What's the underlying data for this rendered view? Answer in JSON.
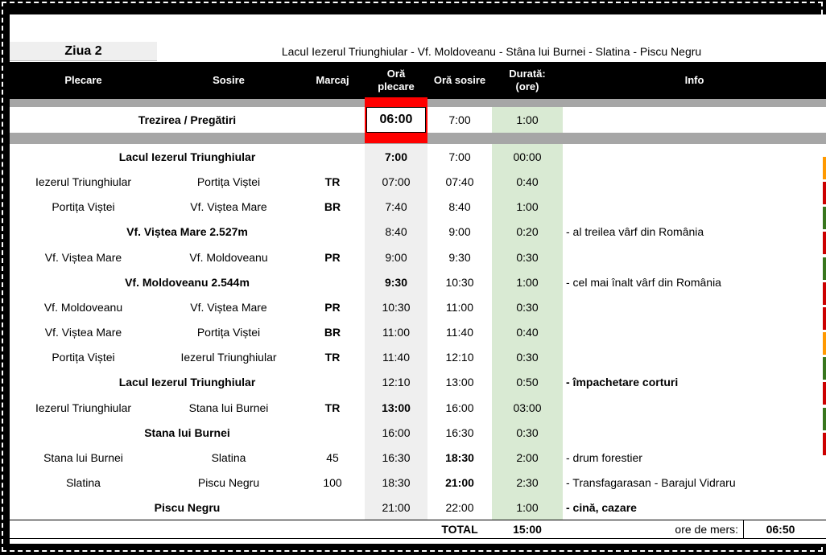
{
  "day": {
    "label": "Ziua 2",
    "route": "Lacul Iezerul Triunghiular - Vf. Moldoveanu - Stâna lui Burnei - Slatina - Piscu Negru"
  },
  "headers": {
    "plecare": "Plecare",
    "sosire": "Sosire",
    "marcaj": "Marcaj",
    "ora_plecare": "Oră plecare",
    "ora_sosire": "Oră sosire",
    "durata": "Durată: (ore)",
    "info": "Info"
  },
  "wake": {
    "label": "Trezirea / Pregătiri",
    "start": "06:00",
    "end": "7:00",
    "duration": "1:00"
  },
  "rows": [
    {
      "merged": "Lacul Iezerul Triunghiular",
      "from": "",
      "to": "",
      "marker": "",
      "start": "7:00",
      "end": "7:00",
      "duration": "00:00",
      "info": "",
      "startBold": true,
      "endBold": false,
      "infoBold": false
    },
    {
      "merged": "",
      "from": "Iezerul Triunghiular",
      "to": "Portița Viștei",
      "marker": "TR",
      "start": "07:00",
      "end": "07:40",
      "duration": "0:40",
      "info": "",
      "startBold": false,
      "endBold": false,
      "infoBold": false
    },
    {
      "merged": "",
      "from": "Portița Viștei",
      "to": "Vf. Viștea Mare",
      "marker": "BR",
      "start": "7:40",
      "end": "8:40",
      "duration": "1:00",
      "info": "",
      "startBold": false,
      "endBold": false,
      "infoBold": false
    },
    {
      "merged": "Vf. Viștea Mare 2.527m",
      "from": "",
      "to": "",
      "marker": "",
      "start": "8:40",
      "end": "9:00",
      "duration": "0:20",
      "info": "-  al treilea vârf din România",
      "startBold": false,
      "endBold": false,
      "infoBold": false
    },
    {
      "merged": "",
      "from": "Vf. Viștea Mare",
      "to": "Vf. Moldoveanu",
      "marker": "PR",
      "start": "9:00",
      "end": "9:30",
      "duration": "0:30",
      "info": "",
      "startBold": false,
      "endBold": false,
      "infoBold": false
    },
    {
      "merged": "Vf. Moldoveanu 2.544m",
      "from": "",
      "to": "",
      "marker": "",
      "start": "9:30",
      "end": "10:30",
      "duration": "1:00",
      "info": "-  cel mai înalt vârf din România",
      "startBold": true,
      "endBold": false,
      "infoBold": false
    },
    {
      "merged": "",
      "from": "Vf. Moldoveanu",
      "to": "Vf. Viștea Mare",
      "marker": "PR",
      "start": "10:30",
      "end": "11:00",
      "duration": "0:30",
      "info": "",
      "startBold": false,
      "endBold": false,
      "infoBold": false
    },
    {
      "merged": "",
      "from": "Vf. Viștea Mare",
      "to": "Portița Viștei",
      "marker": "BR",
      "start": "11:00",
      "end": "11:40",
      "duration": "0:40",
      "info": "",
      "startBold": false,
      "endBold": false,
      "infoBold": false
    },
    {
      "merged": "",
      "from": "Portița Viștei",
      "to": "Iezerul Triunghiular",
      "marker": "TR",
      "start": "11:40",
      "end": "12:10",
      "duration": "0:30",
      "info": "",
      "startBold": false,
      "endBold": false,
      "infoBold": false
    },
    {
      "merged": "Lacul Iezerul Triunghiular",
      "from": "",
      "to": "",
      "marker": "",
      "start": "12:10",
      "end": "13:00",
      "duration": "0:50",
      "info": " - împachetare corturi",
      "startBold": false,
      "endBold": false,
      "infoBold": true
    },
    {
      "merged": "",
      "from": "Iezerul Triunghiular",
      "to": "Stana lui Burnei",
      "marker": "TR",
      "start": "13:00",
      "end": "16:00",
      "duration": "03:00",
      "info": "",
      "startBold": true,
      "endBold": false,
      "infoBold": false
    },
    {
      "merged": "Stana lui Burnei",
      "from": "",
      "to": "",
      "marker": "",
      "start": "16:00",
      "end": "16:30",
      "duration": "0:30",
      "info": "",
      "startBold": false,
      "endBold": false,
      "infoBold": false
    },
    {
      "merged": "",
      "from": "Stana lui Burnei",
      "to": "Slatina",
      "marker": "45",
      "start": "16:30",
      "end": "18:30",
      "duration": "2:00",
      "info": "-  drum forestier",
      "startBold": false,
      "endBold": true,
      "infoBold": false
    },
    {
      "merged": "",
      "from": "Slatina",
      "to": "Piscu Negru",
      "marker": "100",
      "start": "18:30",
      "end": "21:00",
      "duration": "2:30",
      "info": "- Transfagarasan - Barajul Vidraru",
      "startBold": false,
      "endBold": true,
      "infoBold": false
    },
    {
      "merged": "Piscu Negru",
      "from": "",
      "to": "",
      "marker": "",
      "start": "21:00",
      "end": "22:00",
      "duration": "1:00",
      "info": "-  cină, cazare",
      "startBold": false,
      "endBold": false,
      "infoBold": true
    }
  ],
  "total": {
    "label": "TOTAL",
    "value": "15:00",
    "walking_label": "ore de mers:",
    "walking_value": "06:50"
  },
  "colors": {
    "header_bg": "#000000",
    "separator": "#a6a6a6",
    "time_col": "#efefef",
    "duration_col": "#d9ead3",
    "wake_highlight": "#ff0000",
    "side_flags": [
      "#ff9900",
      "#cc0000",
      "#38761d",
      "#cc0000",
      "#38761d",
      "#cc0000",
      "#cc0000",
      "#ff9900",
      "#38761d",
      "#cc0000",
      "#38761d",
      "#cc0000"
    ]
  }
}
